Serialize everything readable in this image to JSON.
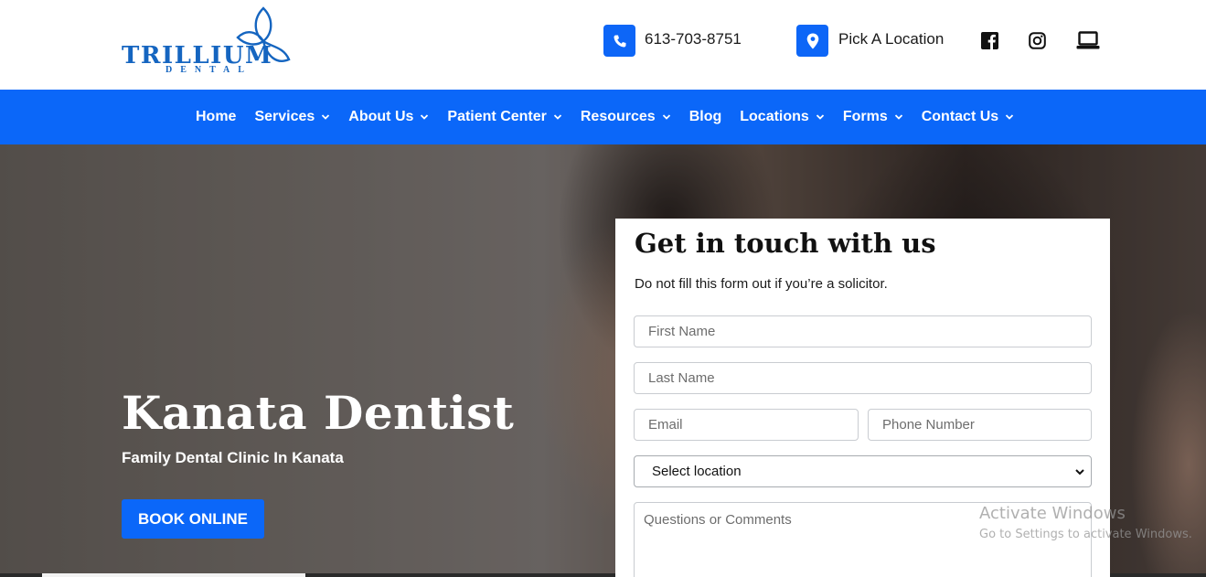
{
  "brand": {
    "name": "TRILLIUM",
    "sub": "DENTAL",
    "color": "#1565c0"
  },
  "header": {
    "phone": "613-703-8751",
    "location_label": "Pick A Location",
    "icons": {
      "phone": "phone-icon",
      "location": "map-pin-icon",
      "facebook": "facebook-icon",
      "instagram": "instagram-icon",
      "portal": "laptop-icon"
    }
  },
  "nav": {
    "color": "#0b67f9",
    "items": [
      {
        "label": "Home",
        "dropdown": false
      },
      {
        "label": "Services",
        "dropdown": true
      },
      {
        "label": "About Us",
        "dropdown": true
      },
      {
        "label": "Patient Center",
        "dropdown": true
      },
      {
        "label": "Resources",
        "dropdown": true
      },
      {
        "label": "Blog",
        "dropdown": false
      },
      {
        "label": "Locations",
        "dropdown": true
      },
      {
        "label": "Forms",
        "dropdown": true
      },
      {
        "label": "Contact Us",
        "dropdown": true
      }
    ]
  },
  "hero": {
    "title": "Kanata Dentist",
    "subtitle": "Family Dental Clinic In Kanata",
    "cta": "BOOK ONLINE"
  },
  "form": {
    "title": "Get in touch with us",
    "note": "Do not fill this form out if you’re a solicitor.",
    "first_name_placeholder": "First Name",
    "last_name_placeholder": "Last Name",
    "email_placeholder": "Email",
    "phone_placeholder": "Phone Number",
    "location_select": "Select location",
    "comments_placeholder": "Questions or Comments"
  },
  "watermark": {
    "line1": "Activate Windows",
    "line2": "Go to Settings to activate Windows."
  }
}
